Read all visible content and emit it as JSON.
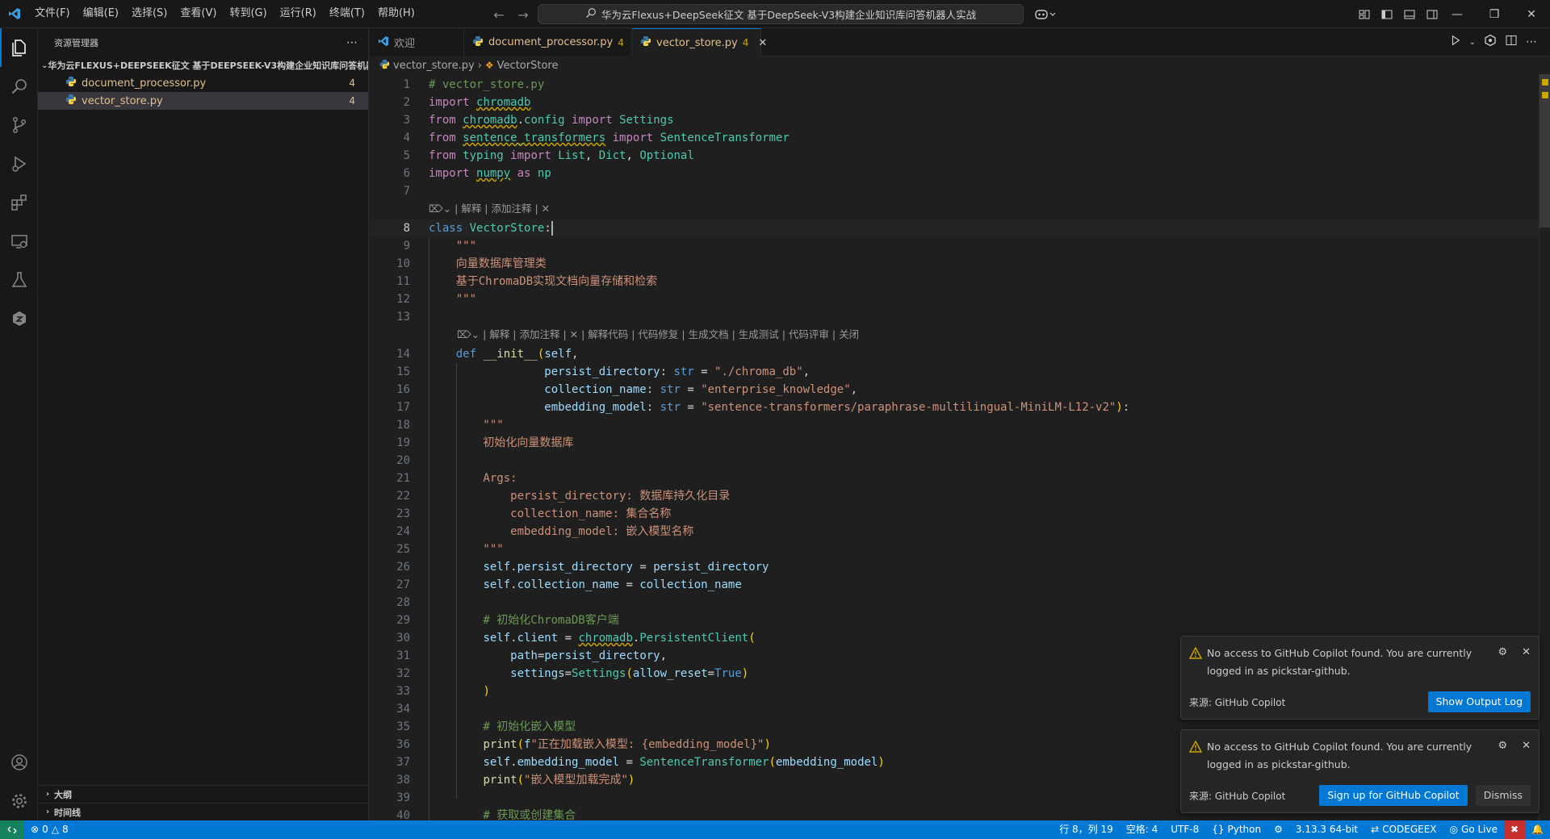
{
  "titlebar": {
    "menus": [
      "文件(F)",
      "编辑(E)",
      "选择(S)",
      "查看(V)",
      "转到(G)",
      "运行(R)",
      "终端(T)",
      "帮助(H)"
    ],
    "search_text": "华为云Flexus+DeepSeek征文 基于DeepSeek-V3构建企业知识库问答机器人实战"
  },
  "sidebar": {
    "title": "资源管理器",
    "folder": "华为云FLEXUS+DEEPSEEK征文 基于DEEPSEEK-V3构建企业知识库问答机器...",
    "files": [
      {
        "name": "document_processor.py",
        "badge": "4"
      },
      {
        "name": "vector_store.py",
        "badge": "4"
      }
    ],
    "outline": "大纲",
    "timeline": "时间线"
  },
  "tabs": [
    {
      "label": "欢迎",
      "badge": ""
    },
    {
      "label": "document_processor.py",
      "badge": "4"
    },
    {
      "label": "vector_store.py",
      "badge": "4"
    }
  ],
  "breadcrumb": {
    "file": "vector_store.py",
    "symbol": "VectorStore"
  },
  "editor": {
    "current_line": 8,
    "lens1": "| 解释 | 添加注释 | ✕",
    "lens2": "| 解释 | 添加注释 | ✕ | 解释代码 | 代码修复 | 生成文档 | 生成测试 | 代码评审 | 关闭",
    "lines": [
      "# vector_store.py",
      "import chromadb",
      "from chromadb.config import Settings",
      "from sentence_transformers import SentenceTransformer",
      "from typing import List, Dict, Optional",
      "import numpy as np",
      "",
      "class VectorStore:",
      "    \"\"\"",
      "    向量数据库管理类",
      "    基于ChromaDB实现文档向量存储和检索",
      "    \"\"\"",
      "",
      "    def __init__(self,",
      "                 persist_directory: str = \"./chroma_db\",",
      "                 collection_name: str = \"enterprise_knowledge\",",
      "                 embedding_model: str = \"sentence-transformers/paraphrase-multilingual-MiniLM-L12-v2\"):",
      "        \"\"\"",
      "        初始化向量数据库",
      "",
      "        Args:",
      "            persist_directory: 数据库持久化目录",
      "            collection_name: 集合名称",
      "            embedding_model: 嵌入模型名称",
      "        \"\"\"",
      "        self.persist_directory = persist_directory",
      "        self.collection_name = collection_name",
      "",
      "        # 初始化ChromaDB客户端",
      "        self.client = chromadb.PersistentClient(",
      "            path=persist_directory,",
      "            settings=Settings(allow_reset=True)",
      "        )",
      "",
      "        # 初始化嵌入模型",
      "        print(f\"正在加载嵌入模型: {embedding_model}\")",
      "        self.embedding_model = SentenceTransformer(embedding_model)",
      "        print(\"嵌入模型加载完成\")",
      "",
      "        # 获取或创建集合",
      "        self.collection = self.client.get_or_create_collection("
    ]
  },
  "notifications": [
    {
      "message": "No access to GitHub Copilot found. You are currently logged in as pickstar-github.",
      "source": "来源: GitHub Copilot",
      "buttons": [
        "Show Output Log"
      ]
    },
    {
      "message": "No access to GitHub Copilot found. You are currently logged in as pickstar-github.",
      "source": "来源: GitHub Copilot",
      "buttons": [
        "Sign up for GitHub Copilot",
        "Dismiss"
      ]
    }
  ],
  "status": {
    "errors": "0",
    "warnings": "8",
    "position": "行 8，列 19",
    "spaces": "空格: 4",
    "encoding": "UTF-8",
    "language": "Python",
    "python_version": "3.13.3 64-bit",
    "codegeex": "CODEGEEX",
    "golive": "Go Live"
  },
  "colors": {
    "accent": "#0078d4",
    "remote": "#16825d",
    "warning": "#cca700"
  }
}
